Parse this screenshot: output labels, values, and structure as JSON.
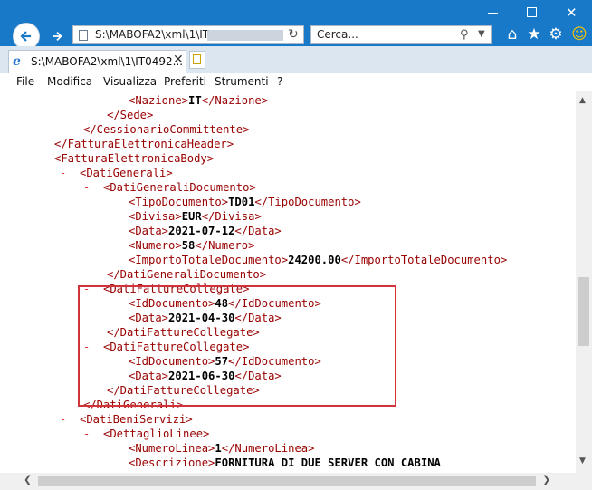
{
  "browser": {
    "address": "S:\\MABOFA2\\xml\\1\\IT",
    "search_placeholder": "Cerca...",
    "tab_title": "S:\\MABOFA2\\xml\\1\\IT0492...",
    "accent_color": "#1979c9"
  },
  "menu": [
    "File",
    "Modifica",
    "Visualizza",
    "Preferiti",
    "Strumenti",
    "?"
  ],
  "xml_lines": [
    {
      "open": "<Nazione>",
      "value": "IT",
      "close": "</Nazione>"
    },
    {
      "text": "</Sede>"
    },
    {
      "text": "</CessionarioCommittente>"
    },
    {
      "text": "</FatturaElettronicaHeader>"
    },
    {
      "toggle": "-",
      "text": "<FatturaElettronicaBody>"
    },
    {
      "toggle": "-",
      "text": "<DatiGenerali>"
    },
    {
      "toggle": "-",
      "text": "<DatiGeneraliDocumento>"
    },
    {
      "open": "<TipoDocumento>",
      "value": "TD01",
      "close": "</TipoDocumento>"
    },
    {
      "open": "<Divisa>",
      "value": "EUR",
      "close": "</Divisa>"
    },
    {
      "open": "<Data>",
      "value": "2021-07-12",
      "close": "</Data>"
    },
    {
      "open": "<Numero>",
      "value": "58",
      "close": "</Numero>"
    },
    {
      "open": "<ImportoTotaleDocumento>",
      "value": "24200.00",
      "close": "</ImportoTotaleDocumento>"
    },
    {
      "text": "</DatiGeneraliDocumento>"
    },
    {
      "toggle": "-",
      "text": "<DatiFattureCollegate>"
    },
    {
      "open": "<IdDocumento>",
      "value": "48",
      "close": "</IdDocumento>"
    },
    {
      "open": "<Data>",
      "value": "2021-04-30",
      "close": "</Data>"
    },
    {
      "text": "</DatiFattureCollegate>"
    },
    {
      "toggle": "-",
      "text": "<DatiFattureCollegate>"
    },
    {
      "open": "<IdDocumento>",
      "value": "57",
      "close": "</IdDocumento>"
    },
    {
      "open": "<Data>",
      "value": "2021-06-30",
      "close": "</Data>"
    },
    {
      "text": "</DatiFattureCollegate>"
    },
    {
      "text": "</DatiGenerali>"
    },
    {
      "toggle": "-",
      "text": "<DatiBeniServizi>"
    },
    {
      "toggle": "-",
      "text": "<DettaglioLinee>"
    },
    {
      "open": "<NumeroLinea>",
      "value": "1",
      "close": "</NumeroLinea>"
    },
    {
      "open": "<Descrizione>",
      "value": "FORNITURA DI DUE SERVER CON CABINA",
      "close": ""
    }
  ],
  "highlight_color": "#d0333a"
}
